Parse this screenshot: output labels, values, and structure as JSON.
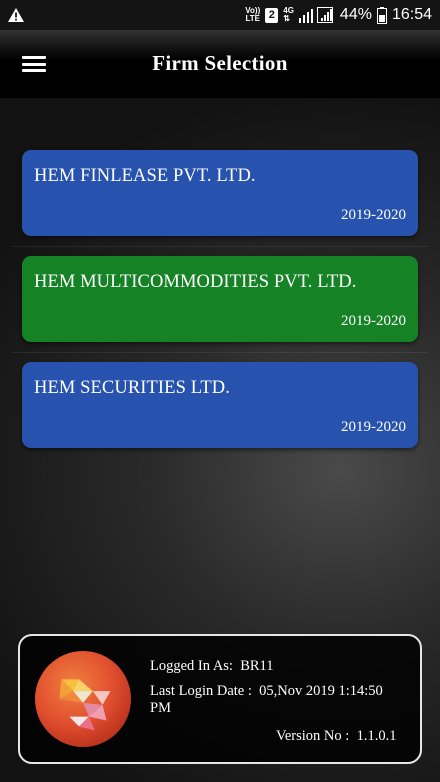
{
  "status_bar": {
    "left_icon": "warning-triangle-icon",
    "volte_top": "Vo))",
    "volte_bottom": "LTE",
    "sim_number": "2",
    "network": "4G",
    "battery": "44%",
    "time": "16:54"
  },
  "header": {
    "menu_icon": "hamburger-menu-icon",
    "title": "Firm Selection"
  },
  "firms": [
    {
      "name": "HEM FINLEASE PVT. LTD.",
      "year": "2019-2020",
      "color": "#2752ad"
    },
    {
      "name": "HEM MULTICOMMODITIES PVT. LTD.",
      "year": "2019-2020",
      "color": "#158225"
    },
    {
      "name": "HEM SECURITIES LTD.",
      "year": "2019-2020",
      "color": "#2752ad"
    }
  ],
  "login_info": {
    "logged_in_label": "Logged In As:",
    "user": "BR11",
    "last_login_label": "Last Login Date :",
    "last_login_value": "05,Nov 2019  1:14:50 PM",
    "version_label": "Version No :",
    "version_value": "1.1.0.1"
  }
}
